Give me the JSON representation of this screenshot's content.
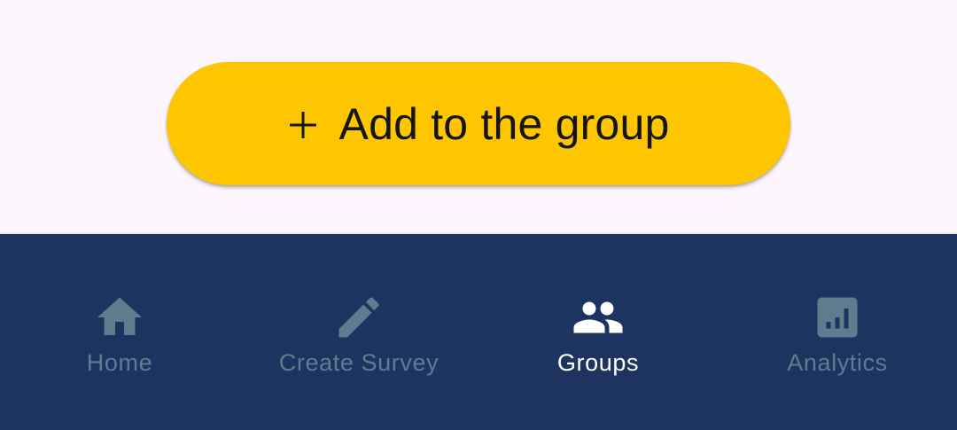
{
  "add_button": {
    "label": "Add to the group",
    "icon": "plus-icon"
  },
  "bottom_nav": {
    "items": [
      {
        "label": "Home",
        "icon": "home-icon",
        "active": false
      },
      {
        "label": "Create Survey",
        "icon": "pencil-icon",
        "active": false
      },
      {
        "label": "Groups",
        "icon": "group-icon",
        "active": true
      },
      {
        "label": "Analytics",
        "icon": "analytics-icon",
        "active": false
      }
    ]
  },
  "colors": {
    "background": "#fdf6fd",
    "button": "#fdc600",
    "nav_background": "#1d3461",
    "nav_inactive": "#5f7c8f",
    "nav_active": "#ffffff"
  }
}
